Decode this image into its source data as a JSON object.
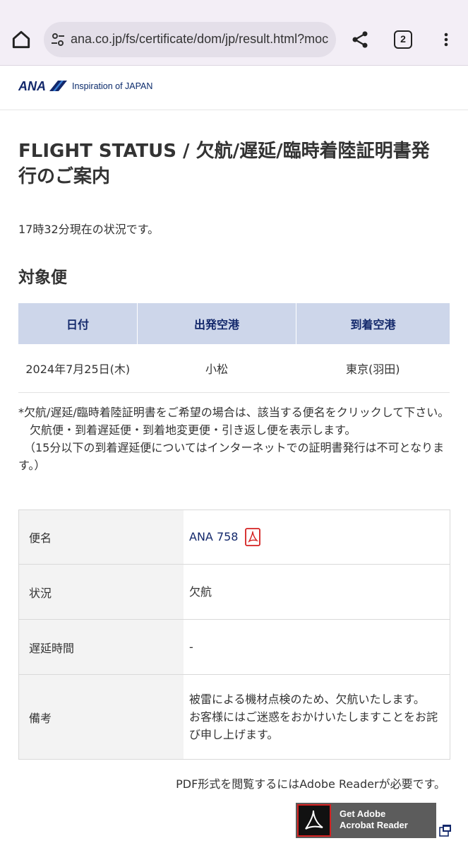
{
  "browser": {
    "url": "ana.co.jp/fs/certificate/dom/jp/result.html?moc",
    "tab_count": "2"
  },
  "header": {
    "logo_text": "ANA",
    "tagline": "Inspiration of JAPAN"
  },
  "page": {
    "title": "FLIGHT STATUS / 欠航/遅延/臨時着陸証明書発行のご案内",
    "status_time": "17時32分現在の状況です。",
    "section_title": "対象便"
  },
  "flight_table": {
    "headers": [
      "日付",
      "出発空港",
      "到着空港"
    ],
    "row": [
      "2024年7月25日(木)",
      "小松",
      "東京(羽田)"
    ]
  },
  "notes": {
    "line1": "*欠航/遅延/臨時着陸証明書をご希望の場合は、該当する便名をクリックして下さい。",
    "line2": "　欠航便・到着遅延便・到着地変更便・引き返し便を表示します。",
    "line3": "　（15分以下の到着遅延便についてはインターネットでの証明書発行は不可となります。）"
  },
  "details": {
    "flight_label": "便名",
    "flight_value": "ANA 758",
    "status_label": "状況",
    "status_value": "欠航",
    "delay_label": "遅延時間",
    "delay_value": "-",
    "remarks_label": "備考",
    "remarks_line1": "被雷による機材点検のため、欠航いたします。",
    "remarks_line2": "お客様にはご迷惑をおかけいたしますことをお詫び申し上げます。"
  },
  "adobe": {
    "note": "PDF形式を閲覧するにはAdobe Readerが必要です。",
    "button_line1": "Get Adobe",
    "button_line2": "Acrobat Reader"
  },
  "icons": {
    "home": "home-icon",
    "site_settings": "tune-icon",
    "share": "share-icon",
    "menu": "more-vert-icon",
    "pdf": "pdf-icon",
    "external": "external-window-icon"
  },
  "colors": {
    "ana_blue": "#13286b",
    "table_header_bg": "#cdd6ea",
    "label_bg": "#f3f3f3",
    "pdf_red": "#d42020"
  }
}
